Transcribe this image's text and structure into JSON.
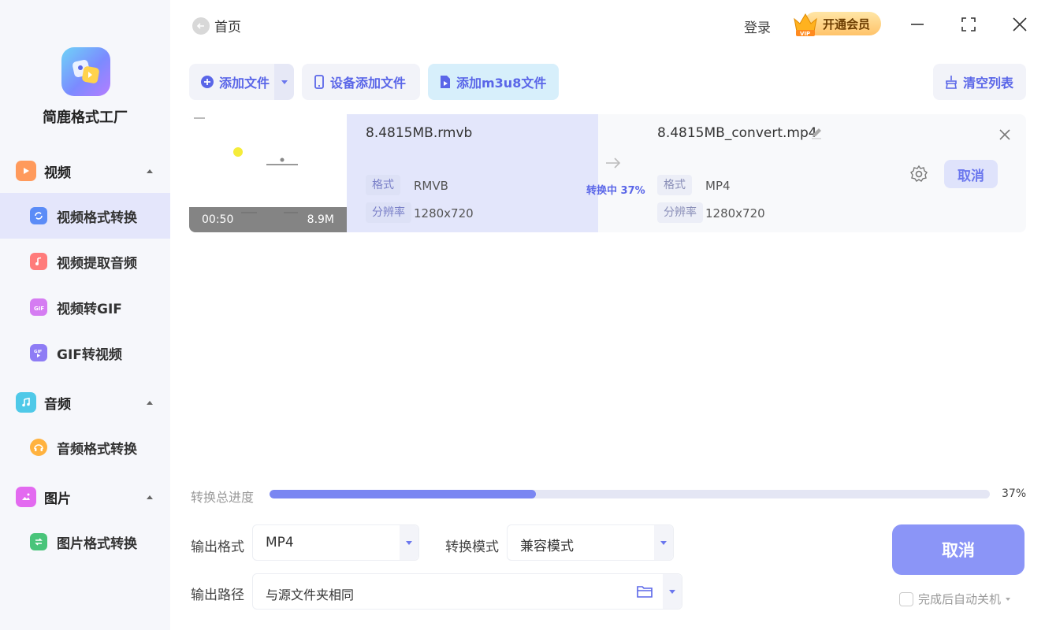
{
  "app": {
    "name": "简鹿格式工厂"
  },
  "sidebar": {
    "groups": [
      {
        "label": "视频",
        "icon": "video-icon",
        "color": "#ff9a5c"
      },
      {
        "label": "音频",
        "icon": "music-icon",
        "color": "#4fc9e8"
      },
      {
        "label": "图片",
        "icon": "image-icon",
        "color": "#e36af0"
      }
    ],
    "items": [
      {
        "label": "视频格式转换",
        "icon": "video-convert-icon",
        "active": true
      },
      {
        "label": "视频提取音频",
        "icon": "extract-audio-icon"
      },
      {
        "label": "视频转GIF",
        "icon": "video-to-gif-icon"
      },
      {
        "label": "GIF转视频",
        "icon": "gif-to-video-icon"
      },
      {
        "label": "音频格式转换",
        "icon": "audio-convert-icon"
      },
      {
        "label": "图片格式转换",
        "icon": "image-convert-icon"
      }
    ]
  },
  "header": {
    "back_label": "首页",
    "login_label": "登录",
    "vip_label": "开通会员",
    "vip_badge": "VIP"
  },
  "toolbar": {
    "add_file": "添加文件",
    "device_add": "设备添加文件",
    "add_m3u8": "添加m3u8文件",
    "clear_list": "清空列表"
  },
  "file": {
    "thumb_duration": "00:50",
    "thumb_size": "8.9M",
    "source_name": "8.4815MB.rmvb",
    "format_tag": "格式",
    "resolution_tag": "分辨率",
    "source_format": "RMVB",
    "source_resolution": "1280x720",
    "status": "转换中 37%",
    "output_name": "8.4815MB_convert.mp4",
    "output_format": "MP4",
    "output_resolution": "1280x720",
    "cancel_label": "取消"
  },
  "progress": {
    "label": "转换总进度",
    "value": 0.37,
    "percent_text": "37%"
  },
  "output": {
    "format_label": "输出格式",
    "format_value": "MP4",
    "mode_label": "转换模式",
    "mode_value": "兼容模式",
    "path_label": "输出路径",
    "path_value": "与源文件夹相同",
    "cancel_label": "取消",
    "shutdown_label": "完成后自动关机"
  },
  "colors": {
    "accent": "#5a66e8",
    "progress": "#7a86f2",
    "big_button": "#8b95f7"
  }
}
